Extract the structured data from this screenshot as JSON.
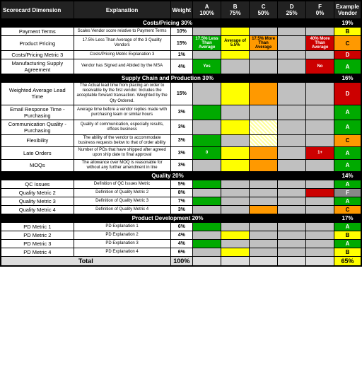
{
  "header": {
    "scorecard_label": "Scorecard Dimension",
    "explanation_label": "Explanation",
    "weight_label": "Weight",
    "a_label": "A",
    "a_pct": "100%",
    "b_label": "B",
    "b_pct": "75%",
    "c_label": "C",
    "c_pct": "50%",
    "d_label": "D",
    "d_pct": "25%",
    "f_label": "F",
    "f_pct": "0%",
    "example_label": "Example",
    "vendor_label": "Vendor"
  },
  "sections": [
    {
      "name": "Costs/Pricing",
      "weight": "30%",
      "example_score": "19%",
      "rows": [
        {
          "dimension": "Payment Terms",
          "explanation": "Scales Vendor score relative to Payment Terms",
          "weight": "10%",
          "a": "",
          "b": "",
          "c": "",
          "d": "",
          "f": "",
          "a_style": "gray",
          "b_style": "yellow",
          "c_style": "gray",
          "d_style": "gray",
          "f_style": "gray",
          "example": "B",
          "example_style": "score-b"
        },
        {
          "dimension": "Product Pricing",
          "explanation": "17.5% Less Than Average of the 3 Quality Vendors",
          "weight": "15%",
          "a_text": "17.5% Less Than Average",
          "b_text": "Average of 5.5%",
          "c_text": "17.5% More Than Average",
          "d_text": "",
          "f_text": "40% More Than Average",
          "a_style": "green",
          "b_style": "yellow",
          "c_style": "orange",
          "d_style": "gray",
          "f_style": "red",
          "example": "C",
          "example_style": "score-c"
        },
        {
          "dimension": "Costs/Pricing Metric 3",
          "explanation": "Costs/Pricing Metric Explanation 3",
          "weight": "1%",
          "a_style": "gray",
          "b_style": "yellow",
          "c_style": "gray",
          "d_style": "gray",
          "f_style": "gray",
          "example": "D",
          "example_style": "score-d"
        },
        {
          "dimension": "Manufacturing Supply Agreement",
          "explanation": "Vendor has Signed and Abided by the MSA",
          "weight": "4%",
          "a_text": "Yes",
          "b_text": "",
          "c_text": "",
          "d_text": "",
          "f_text": "No",
          "a_style": "green",
          "b_style": "gray",
          "c_style": "gray",
          "d_style": "gray",
          "f_style": "red",
          "example": "A",
          "example_style": "score-a"
        }
      ]
    },
    {
      "name": "Supply Chain and Production",
      "weight": "30%",
      "example_score": "16%",
      "rows": [
        {
          "dimension": "Weighted Average Lead Time",
          "explanation": "The Actual lead time from placing an order to receivable by the first vendor. Includes the acceptable forward transaction. Weighted by the Qty Ordered.",
          "weight": "15%",
          "a_style": "gray",
          "b_style": "yellow",
          "c_style": "orange",
          "d_style": "gray",
          "f_style": "gray",
          "example": "D",
          "example_style": "score-d"
        },
        {
          "dimension": "Email Response Time - Purchasing",
          "explanation": "Average time before a vendor replies made with purchasing team or similar hours",
          "weight": "3%",
          "a_style": "green",
          "b_style": "gray",
          "c_style": "gray",
          "d_style": "gray",
          "f_style": "gray",
          "example": "A",
          "example_style": "score-a"
        },
        {
          "dimension": "Communication Quality - Purchasing",
          "explanation": "Quality of communication, especially results, offices business",
          "weight": "3%",
          "a_style": "gray",
          "b_style": "yellow",
          "c_style": "dotted",
          "d_style": "gray",
          "f_style": "gray",
          "example": "A",
          "example_style": "score-a"
        },
        {
          "dimension": "Flexibility",
          "explanation": "The ability of the vendor to accommodate business requests below to that of order ability",
          "weight": "3%",
          "a_style": "green",
          "b_style": "gray",
          "c_style": "dotted",
          "d_style": "gray",
          "f_style": "gray",
          "example": "C",
          "example_style": "score-c"
        },
        {
          "dimension": "Late Orders",
          "explanation": "Number of POs that have shipped after agreed upon ship date to final approval",
          "weight": "3%",
          "a_text": "0",
          "b_text": "",
          "c_text": "",
          "d_text": "",
          "f_text": "1+",
          "a_style": "green",
          "b_style": "yellow",
          "c_style": "orange",
          "d_style": "gray",
          "f_style": "red",
          "example": "A",
          "example_style": "score-a"
        },
        {
          "dimension": "MOQs",
          "explanation": "The allowance over MOQ is reasonable for without any further amendment in line",
          "weight": "3%",
          "a_style": "gray",
          "b_style": "yellow",
          "c_style": "orange",
          "d_style": "gray",
          "f_style": "gray",
          "example": "A",
          "example_style": "score-a"
        }
      ]
    },
    {
      "name": "Quality",
      "weight": "20%",
      "example_score": "14%",
      "rows": [
        {
          "dimension": "QC Issues",
          "explanation": "Definition of QC Issues Metric",
          "weight": "5%",
          "a_style": "green",
          "b_style": "gray",
          "c_style": "gray",
          "d_style": "gray",
          "f_style": "gray",
          "example": "A",
          "example_style": "score-a"
        },
        {
          "dimension": "Quality Metric 2",
          "explanation": "Definition of Quality Metric 2",
          "weight": "8%",
          "a_style": "gray",
          "b_style": "gray",
          "c_style": "gray",
          "d_style": "gray",
          "f_style": "red",
          "example": "F",
          "example_style": "score-f"
        },
        {
          "dimension": "Quality Metric 3",
          "explanation": "Definition of Quality Metric 3",
          "weight": "7%",
          "a_style": "green",
          "b_style": "gray",
          "c_style": "gray",
          "d_style": "gray",
          "f_style": "gray",
          "example": "A",
          "example_style": "score-a"
        },
        {
          "dimension": "Quality Metric 4",
          "explanation": "Definition of Quality Metric 4",
          "weight": "3%",
          "a_style": "gray",
          "b_style": "gray",
          "c_style": "orange",
          "d_style": "gray",
          "f_style": "gray",
          "example": "C",
          "example_style": "score-c"
        }
      ]
    },
    {
      "name": "Product Development",
      "weight": "20%",
      "example_score": "17%",
      "rows": [
        {
          "dimension": "PD Metric 1",
          "explanation": "PD Explanation 1",
          "weight": "6%",
          "a_style": "green",
          "b_style": "gray",
          "c_style": "gray",
          "d_style": "gray",
          "f_style": "gray",
          "example": "A",
          "example_style": "score-a"
        },
        {
          "dimension": "PD Metric 2",
          "explanation": "PD Explanation 2",
          "weight": "4%",
          "a_style": "gray",
          "b_style": "yellow",
          "c_style": "gray",
          "d_style": "gray",
          "f_style": "gray",
          "example": "B",
          "example_style": "score-b"
        },
        {
          "dimension": "PD Metric 3",
          "explanation": "PD Explanation 3",
          "weight": "4%",
          "a_style": "green",
          "b_style": "gray",
          "c_style": "gray",
          "d_style": "gray",
          "f_style": "gray",
          "example": "A",
          "example_style": "score-a"
        },
        {
          "dimension": "PD Metric 4",
          "explanation": "PD Explanation 4",
          "weight": "6%",
          "a_style": "gray",
          "b_style": "yellow",
          "c_style": "gray",
          "d_style": "gray",
          "f_style": "gray",
          "example": "B",
          "example_style": "score-b"
        }
      ]
    }
  ],
  "total": {
    "label": "Total",
    "weight": "100%",
    "example_score": "65%"
  }
}
